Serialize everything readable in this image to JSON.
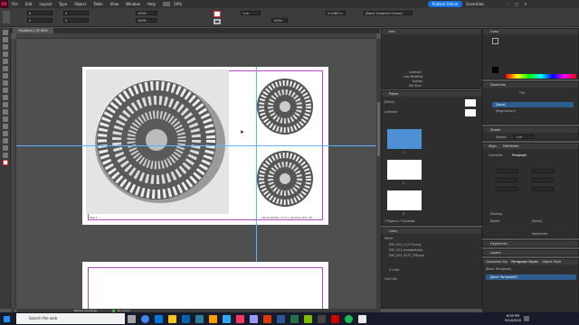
{
  "app": {
    "logo": "Id"
  },
  "menu": [
    "File",
    "Edit",
    "Layout",
    "Type",
    "Object",
    "Table",
    "View",
    "Window",
    "Help"
  ],
  "zoom": "50%",
  "frame_field": "[Basic Graphics Frame]",
  "publish_label": "Publish Online",
  "workspace": "Essentials",
  "control": {
    "x": "0",
    "y": "0",
    "w": "0",
    "h": "0",
    "stroke": "1 pt",
    "scale": "100%",
    "rotate": "0.4583 in"
  },
  "document": {
    "tab": "*Untitled-1 @ 50%",
    "slug_left": "Page 1",
    "slug_right": "Gheorse Mandale - Vol 12 A - November 2022 - 001"
  },
  "status": {
    "page": "1",
    "preflight": "[Basic] (working)",
    "errors": "No errors"
  },
  "info": {
    "title": "Info",
    "fields": [
      "Location:",
      "Last Modified:",
      "Author:",
      "File Size:"
    ]
  },
  "pages": {
    "title": "Pages",
    "none": "[None]",
    "master": "A-Master",
    "page_nums": [
      "1",
      "2",
      "3"
    ],
    "footer": "3 Pages in 3 Spreads"
  },
  "links": {
    "title": "Links",
    "name_col": "Name",
    "items": [
      "DSC_001_cl_0170.png",
      "DSC_001_enlarged.png",
      "DSC_001_0270_338.png"
    ],
    "footer": "3 Links",
    "link_info": "Link Info"
  },
  "color": {
    "title": "Color"
  },
  "swatches": {
    "title": "Swatches",
    "tint": "Tint",
    "items": [
      "[None]",
      "[Registration]"
    ],
    "selected": "[None]"
  },
  "stroke": {
    "title": "Stroke",
    "weight": "Weight:",
    "weight_val": "1 pt"
  },
  "align": {
    "title": "Align",
    "pathfinder": "Pathfinder"
  },
  "character": {
    "tab": "Character",
    "paragraph": "Paragraph",
    "shading": "Shading",
    "border": "Border",
    "swatch": "[None]",
    "hyphenate": "Hyphenate"
  },
  "hyperlinks": {
    "title": "Hyperlinks"
  },
  "layers": {
    "title": "Layers"
  },
  "styles": {
    "char_styles": "Character Sty",
    "para_styles": "Paragraph Styles",
    "object_styles": "Object Style",
    "basic_para": "[Basic Paragraph]",
    "basic_para_sel": "[Basic Paragraph]+"
  },
  "taskbar": {
    "search": "Search the web",
    "time": "8:59 PM",
    "date": "9/14/2020"
  },
  "colors": {
    "indesign": "#ff3366",
    "accent": "#1473e6",
    "guide": "#5fb2ff",
    "margin": "#c046c8"
  }
}
